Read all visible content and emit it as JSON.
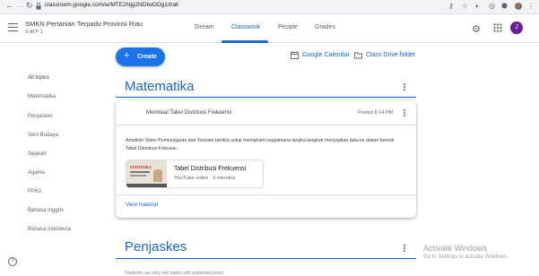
{
  "browser": {
    "url": "classroom.google.com/w/MTE2Njg2NDIwODg1/t/all"
  },
  "header": {
    "class_name": "SMKN Pertanian Terpadu Provinsi Riau",
    "section": "X ATP 1",
    "tabs": [
      {
        "label": "Stream",
        "active": false
      },
      {
        "label": "Classwork",
        "active": true
      },
      {
        "label": "People",
        "active": false
      },
      {
        "label": "Grades",
        "active": false
      }
    ],
    "avatar_letter": "J"
  },
  "toolbar": {
    "create_label": "Create",
    "calendar_label": "Google Calendar",
    "drive_label": "Class Drive folder"
  },
  "sidebar": {
    "topics": [
      "All topics",
      "Matematika",
      "Penjaskes",
      "Seni Budaya",
      "Sejarah",
      "Agama",
      "PPKn",
      "Bahasa Inggris",
      "Bahasa Indonesia"
    ]
  },
  "main": {
    "topic1_title": "Matematika",
    "assignment": {
      "title": "Membuat Tabel Distribusi Frekuensi",
      "posted": "Posted 6:14 PM",
      "description": "Amatilah Video Pembelajaran dari Youtube berikut untuk memahami bagaimana langka-langkah menyajikan data ke dalam bentuk Tabel Distribusi Frekuesi.",
      "attachment": {
        "title": "Tabel Distribusi Frekuensi",
        "subtitle": "YouTube video · 5 minutes",
        "thumb_text": "STATISTIKA"
      },
      "view_material": "View material"
    },
    "topic2_title": "Penjaskes",
    "topic2_hint": "Students can only see topics with published posts"
  },
  "watermark": {
    "line1": "Activate Windows",
    "line2": "Go to Settings to activate Windows."
  },
  "colors": {
    "accent": "#1967d2",
    "create_button": "#1a73e8",
    "avatar": "#6a1b9a"
  }
}
